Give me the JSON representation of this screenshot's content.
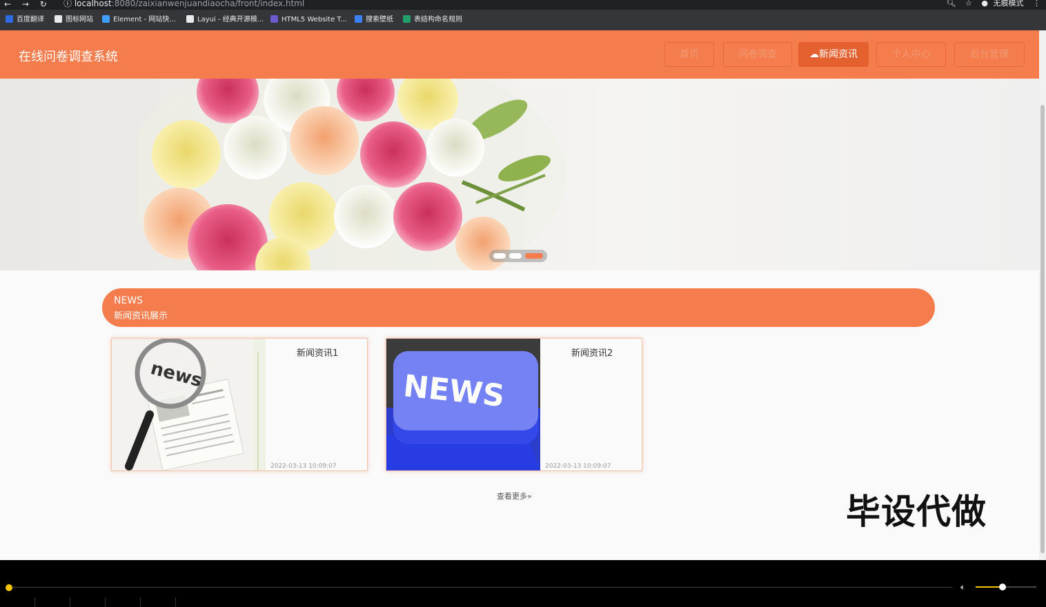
{
  "browser": {
    "url_host": "localhost",
    "url_path": ":8080/zaixianwenjuandiaocha/front/index.html",
    "profile_label": "无痕模式",
    "nav_icons": [
      "back-icon",
      "forward-icon",
      "reload-icon"
    ]
  },
  "bookmarks": [
    {
      "label": "百度翻译",
      "icon_color": "#2d6ae3"
    },
    {
      "label": "图标网站",
      "icon_color": "#e8eaed"
    },
    {
      "label": "Element - 网站快...",
      "icon_color": "#409eff"
    },
    {
      "label": "Layui - 经典开源模...",
      "icon_color": "#e8eaed"
    },
    {
      "label": "HTML5 Website T...",
      "icon_color": "#6a5acd"
    },
    {
      "label": "搜索壁纸",
      "icon_color": "#3b82f6"
    },
    {
      "label": "表结构命名规则",
      "icon_color": "#22a06b"
    }
  ],
  "header": {
    "site_title": "在线问卷调查系统",
    "nav": [
      {
        "label": "首页"
      },
      {
        "label": "问卷调查"
      },
      {
        "label": "新闻资讯",
        "active": true
      },
      {
        "label": "个人中心"
      },
      {
        "label": "后台管理"
      }
    ]
  },
  "banner": {
    "slides": 3,
    "active_slide": 3
  },
  "news_section": {
    "title_en": "NEWS",
    "title_cn": "新闻资讯展示",
    "items": [
      {
        "title": "新闻资讯1",
        "date": "2022-03-13 10:09:07",
        "image_label": "news"
      },
      {
        "title": "新闻资讯2",
        "date": "2022-03-13 10:09:07",
        "image_label": "NEWS"
      }
    ],
    "more_label": "查看更多"
  },
  "watermark": "毕设代做",
  "player": {
    "seek_fraction": 0.0,
    "volume_fraction": 0.45
  },
  "colors": {
    "primary": "#f57c4c",
    "primary_dark": "#e4602f"
  }
}
